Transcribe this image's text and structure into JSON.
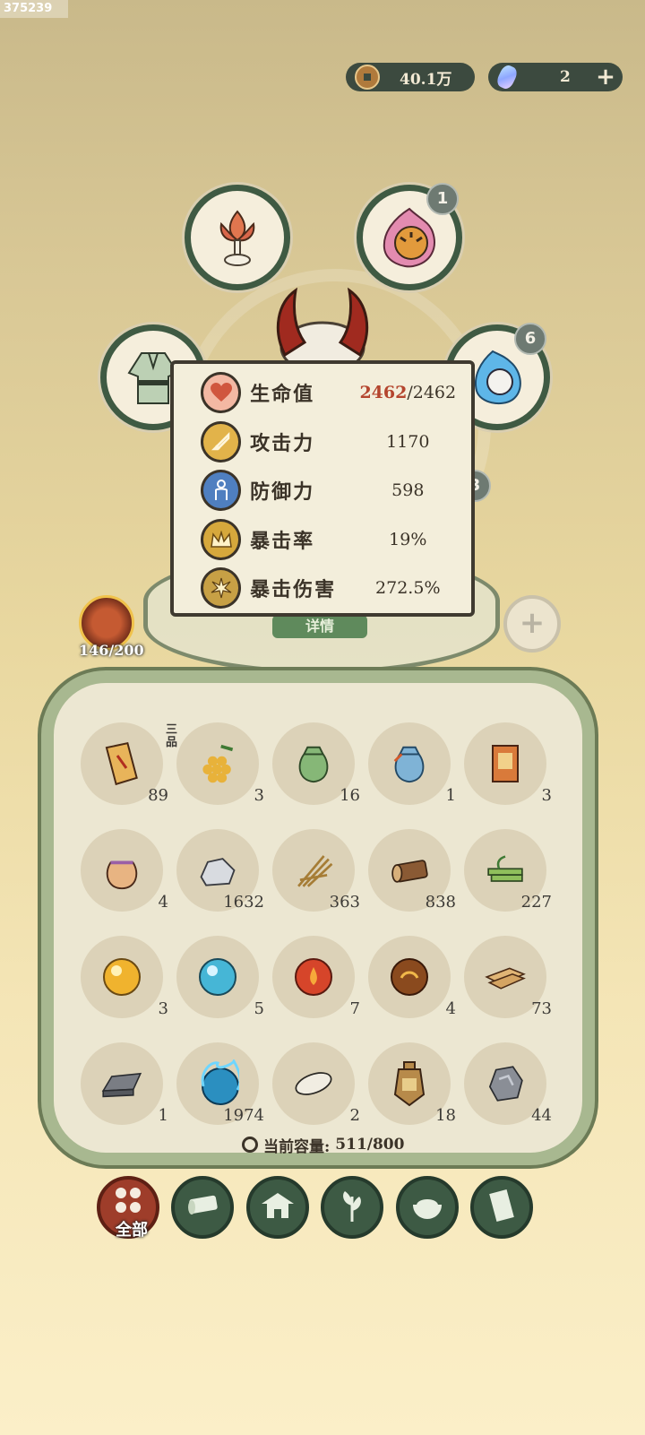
{
  "debug_id": "375239",
  "currencies": {
    "coins": "40.1万",
    "gems": "2"
  },
  "equipment": {
    "tiger_badge": "1",
    "spirit_badge": "6",
    "hidden_badge": "3"
  },
  "stats": [
    {
      "label": "生命值",
      "current": "2462",
      "max": "/2462",
      "icon": "heart-icon"
    },
    {
      "label": "攻击力",
      "value": "1170",
      "icon": "sword-icon"
    },
    {
      "label": "防御力",
      "value": "598",
      "icon": "shield-person-icon"
    },
    {
      "label": "暴击率",
      "value": "19%",
      "icon": "crown-icon"
    },
    {
      "label": "暴击伤害",
      "value": "272.5%",
      "icon": "burst-icon"
    }
  ],
  "detail_button": "详情",
  "avatar": {
    "count": "146/200"
  },
  "inventory": {
    "grade_tag": "三品",
    "items": [
      {
        "icon": "scroll-icon",
        "count": "89"
      },
      {
        "icon": "grapes-icon",
        "count": "3"
      },
      {
        "icon": "green-pouch-icon",
        "count": "16"
      },
      {
        "icon": "blue-pouch-icon",
        "count": "1"
      },
      {
        "icon": "talisman-icon",
        "count": "3"
      },
      {
        "icon": "purple-pouch-icon",
        "count": "4"
      },
      {
        "icon": "stone-icon",
        "count": "1632"
      },
      {
        "icon": "straw-icon",
        "count": "363"
      },
      {
        "icon": "log-icon",
        "count": "838"
      },
      {
        "icon": "bamboo-icon",
        "count": "227"
      },
      {
        "icon": "gold-orb-icon",
        "count": "3"
      },
      {
        "icon": "cyan-orb-icon",
        "count": "5"
      },
      {
        "icon": "red-orb-icon",
        "count": "7"
      },
      {
        "icon": "brown-orb-icon",
        "count": "4"
      },
      {
        "icon": "planks-icon",
        "count": "73"
      },
      {
        "icon": "iron-ingot-icon",
        "count": "1"
      },
      {
        "icon": "spirit-orb-icon",
        "count": "1974"
      },
      {
        "icon": "rice-grain-icon",
        "count": "2"
      },
      {
        "icon": "token-icon",
        "count": "18"
      },
      {
        "icon": "ore-icon",
        "count": "44"
      }
    ],
    "capacity_label": "当前容量:",
    "capacity_value": "511/800"
  },
  "tabs": [
    {
      "label": "全部",
      "icon": "grid-icon",
      "active": true
    },
    {
      "label": "",
      "icon": "log-tab-icon"
    },
    {
      "label": "",
      "icon": "house-tab-icon"
    },
    {
      "label": "",
      "icon": "herb-tab-icon"
    },
    {
      "label": "",
      "icon": "bowl-tab-icon"
    },
    {
      "label": "",
      "icon": "scroll-tab-icon"
    }
  ],
  "colors": {
    "accent_green": "#3d5a44",
    "hp_red": "#b4452e",
    "active_tab": "#9e3d2a"
  }
}
